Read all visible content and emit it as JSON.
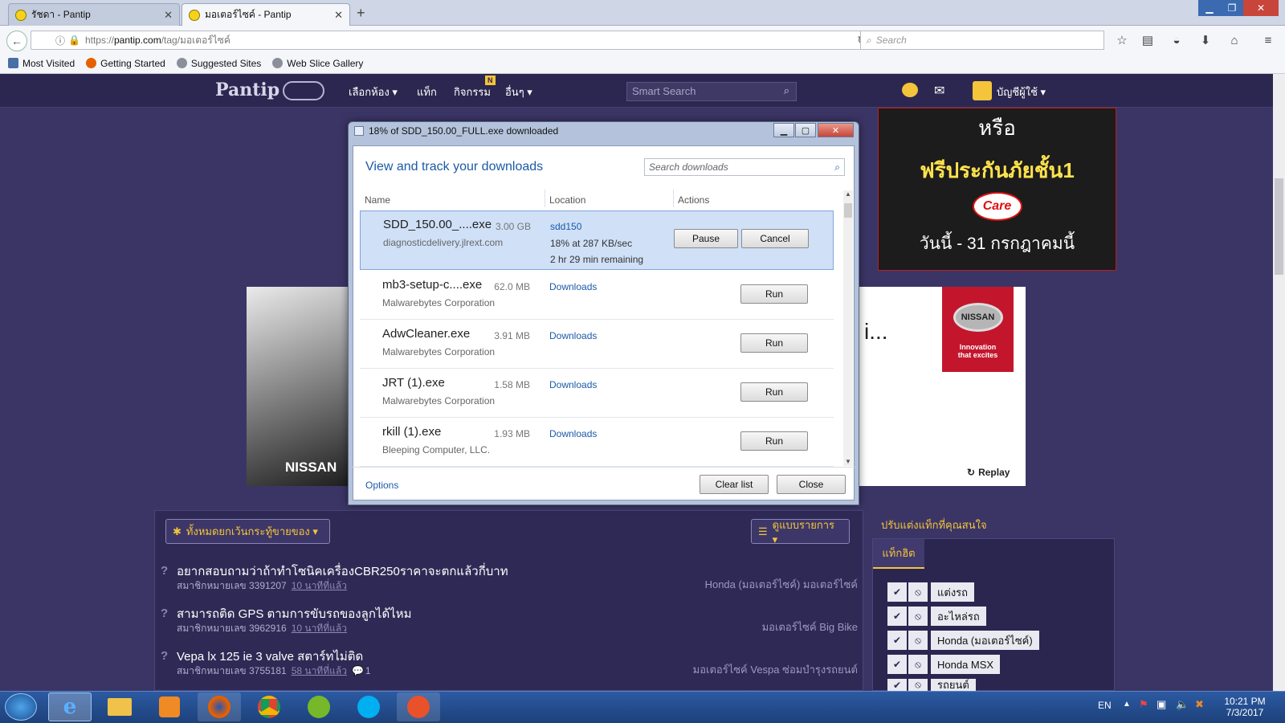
{
  "browser": {
    "tabs": [
      {
        "title": "รัชดา - Pantip",
        "active": false
      },
      {
        "title": "มอเตอร์ไซค์ - Pantip",
        "active": true
      }
    ],
    "url": "https://pantip.com/tag/มอเตอร์ไซค์",
    "url_prefix": "https://",
    "url_host": "pantip.com",
    "url_path": "/tag/มอเตอร์ไซค์",
    "search_placeholder": "Search",
    "bookmarks": [
      "Most Visited",
      "Getting Started",
      "Suggested Sites",
      "Web Slice Gallery"
    ]
  },
  "site": {
    "logo": "Pantip",
    "nav": [
      "เลือกห้อง ▾",
      "แท็ก",
      "กิจกรรม",
      "อื่นๆ ▾"
    ],
    "new_badge": "N",
    "smart_search_placeholder": "Smart Search",
    "account_label": "บัญชีผู้ใช้ ▾"
  },
  "ads": {
    "top_line1": "หรือ",
    "top_line2": "ฟรีประกันภัยชั้น1",
    "top_care": "Care",
    "top_line3": "วันนี้ - 31 กรกฎาคมนี้",
    "left_brand": "NISSAN",
    "nissan_logo": "NISSAN",
    "nissan_tagline1": "Innovation",
    "nissan_tagline2": "that excites",
    "mid_text": "i...",
    "replay": "Replay"
  },
  "forum": {
    "filter_label": "ทั้งหมดยกเว้นกระทู้ขายของ ▾",
    "view_label": "ดูแบบรายการ ▾",
    "topics": [
      {
        "title": "อยากสอบถามว่าถ้าทำโซนิคเครื่องCBR250ราคาจะตกแล้วกี่บาท",
        "member": "สมาชิกหมายเลข 3391207",
        "time": "10 นาทีที่แล้ว",
        "comments": "",
        "tags": "Honda (มอเตอร์ไซค์)  มอเตอร์ไซค์"
      },
      {
        "title": "สามารถติด GPS ตามการขับรถของลูกได้ไหม",
        "member": "สมาชิกหมายเลข 3962916",
        "time": "10 นาทีที่แล้ว",
        "comments": "",
        "tags": "มอเตอร์ไซค์  Big Bike"
      },
      {
        "title": "Vepa lx 125 ie 3 valve สตาร์ทไม่ติด",
        "member": "สมาชิกหมายเลข 3755181",
        "time": "58 นาทีที่แล้ว",
        "comments": "1",
        "tags": "มอเตอร์ไซค์  Vespa  ซ่อมบำรุงรถยนต์"
      }
    ]
  },
  "sidebar": {
    "title": "ปรับแต่งแท็กที่คุณสนใจ",
    "tab": "แท็กฮิต",
    "tags": [
      "แต่งรถ",
      "อะไหล่รถ",
      "Honda (มอเตอร์ไซค์)",
      "Honda MSX",
      "รถยนต์"
    ]
  },
  "download_dialog": {
    "title": "18% of SDD_150.00_FULL.exe downloaded",
    "heading": "View and track your downloads",
    "search_placeholder": "Search downloads",
    "columns": [
      "Name",
      "Location",
      "Actions"
    ],
    "items": [
      {
        "name": "SDD_150.00_....exe",
        "size": "3.00 GB",
        "publisher": "diagnosticdelivery.jlrext.com",
        "location": "sdd150",
        "progress": "18% at 287 KB/sec",
        "remaining": "2 hr 29 min remaining",
        "actions": [
          "Pause",
          "Cancel"
        ]
      },
      {
        "name": "mb3-setup-c....exe",
        "size": "62.0 MB",
        "publisher": "Malwarebytes Corporation",
        "location": "Downloads",
        "actions": [
          "Run"
        ]
      },
      {
        "name": "AdwCleaner.exe",
        "size": "3.91 MB",
        "publisher": "Malwarebytes Corporation",
        "location": "Downloads",
        "actions": [
          "Run"
        ]
      },
      {
        "name": "JRT (1).exe",
        "size": "1.58 MB",
        "publisher": "Malwarebytes Corporation",
        "location": "Downloads",
        "actions": [
          "Run"
        ]
      },
      {
        "name": "rkill (1).exe",
        "size": "1.93 MB",
        "publisher": "Bleeping Computer, LLC.",
        "location": "Downloads",
        "actions": [
          "Run"
        ]
      }
    ],
    "options": "Options",
    "clear_list": "Clear list",
    "close": "Close"
  },
  "taskbar": {
    "lang": "EN",
    "time": "10:21 PM",
    "date": "7/3/2017"
  },
  "colors": {
    "page_bg": "#3b3566",
    "accent_yellow": "#f4c43a",
    "link_blue": "#1b5aa8",
    "ad_red": "#c3162c"
  }
}
